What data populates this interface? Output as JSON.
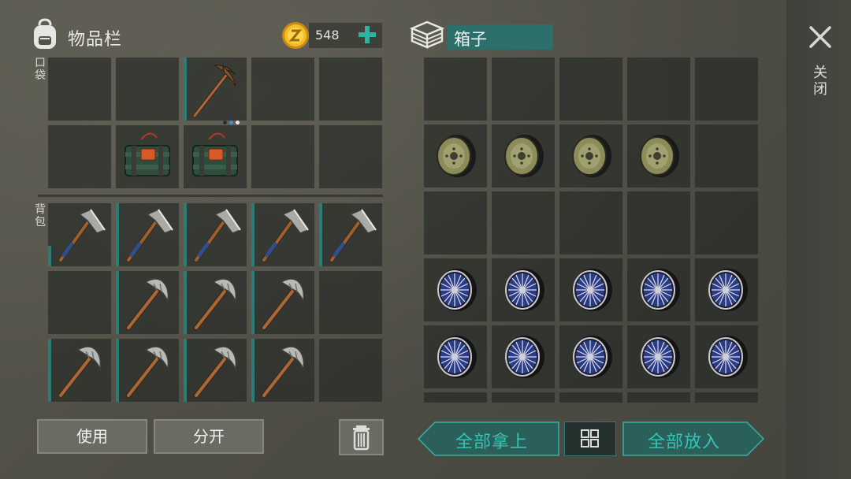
{
  "inventory": {
    "title": "物品栏",
    "pocket_label": "口袋",
    "backpack_label": "背包",
    "coins": "548",
    "pocket": [
      {
        "item": ""
      },
      {
        "item": ""
      },
      {
        "item": "pickaxe",
        "durability_stripe": "full",
        "pages": 3,
        "active_page": 2
      },
      {
        "item": ""
      },
      {
        "item": ""
      },
      {
        "item": ""
      },
      {
        "item": "c4-explosive"
      },
      {
        "item": "c4-explosive"
      },
      {
        "item": ""
      },
      {
        "item": ""
      }
    ],
    "backpack": [
      {
        "item": "hatchet",
        "durability_stripe": "partial"
      },
      {
        "item": "hatchet",
        "durability_stripe": "full"
      },
      {
        "item": "hatchet",
        "durability_stripe": "full"
      },
      {
        "item": "hatchet",
        "durability_stripe": "full"
      },
      {
        "item": "hatchet",
        "durability_stripe": "full"
      },
      {
        "item": ""
      },
      {
        "item": "stone-pickaxe",
        "durability_stripe": "full"
      },
      {
        "item": "stone-pickaxe",
        "durability_stripe": "full"
      },
      {
        "item": "stone-pickaxe",
        "durability_stripe": "full"
      },
      {
        "item": ""
      },
      {
        "item": "stone-pickaxe",
        "durability_stripe": "full"
      },
      {
        "item": "stone-pickaxe",
        "durability_stripe": "full"
      },
      {
        "item": "stone-pickaxe",
        "durability_stripe": "full"
      },
      {
        "item": "stone-pickaxe",
        "durability_stripe": "full"
      },
      {
        "item": ""
      }
    ]
  },
  "box": {
    "title": "箱子",
    "slots": [
      "",
      "",
      "",
      "",
      "",
      "car-wheel",
      "car-wheel",
      "car-wheel",
      "car-wheel",
      "",
      "",
      "",
      "",
      "",
      "",
      "bike-wheel",
      "bike-wheel",
      "bike-wheel",
      "bike-wheel",
      "bike-wheel",
      "bike-wheel",
      "bike-wheel",
      "bike-wheel",
      "bike-wheel",
      "bike-wheel"
    ]
  },
  "actions": {
    "use": "使用",
    "split": "分开",
    "take_all": "全部拿上",
    "put_all": "全部放入",
    "close": "关闭"
  },
  "icons": {
    "backpack": "backpack-icon",
    "coin": "coin-icon",
    "add": "plus-icon",
    "box": "box-icon",
    "close": "close-icon",
    "trash": "trash-icon",
    "sort": "grid-sort-icon"
  },
  "colors": {
    "accent": "#33c5b3",
    "stripe": "#2a7c76",
    "title_field": "#2c6f6a"
  }
}
